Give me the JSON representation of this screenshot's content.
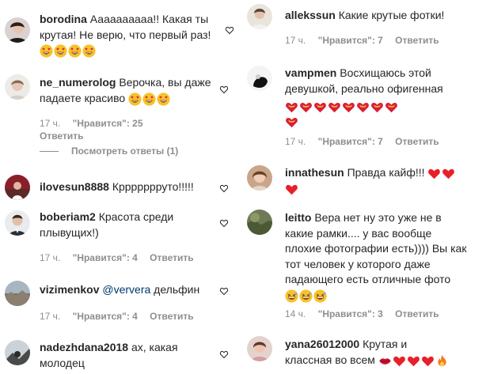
{
  "comments_left": [
    {
      "username": "borodina",
      "text": "Аааааааааа!! Какая ты крутая! Не верю, что первый раз!",
      "emojis": [
        "heart-eyes",
        "heart-eyes",
        "heart-eyes",
        "heart-eyes"
      ]
    },
    {
      "username": "ne_numerolog",
      "text": "Верочка, вы даже падаете красиво",
      "emojis": [
        "heart-eyes",
        "heart-eyes",
        "heart-eyes"
      ],
      "time": "17 ч.",
      "likes": "\"Нравится\": 25",
      "reply": "Ответить",
      "view_replies": "Посмотреть ответы (1)"
    },
    {
      "username": "ilovesun8888",
      "text": "Кррррррруто!!!!!"
    },
    {
      "username": "boberiam2",
      "text": "Красота среди плывущих!)",
      "time": "17 ч.",
      "likes": "\"Нравится\": 4",
      "reply": "Ответить"
    },
    {
      "username": "vizimenkov",
      "mention": "@ververa",
      "text": "дельфин",
      "time": "17 ч.",
      "likes": "\"Нравится\": 4",
      "reply": "Ответить"
    },
    {
      "username": "nadezhdana2018",
      "text": "ах, какая молодец"
    }
  ],
  "comments_right": [
    {
      "username": "allekssun",
      "text": "Какие крутые фотки!",
      "time": "17 ч.",
      "likes": "\"Нравится\": 7",
      "reply": "Ответить"
    },
    {
      "username": "vampmen",
      "text": "Восхищаюсь этой девушкой, реально офигенная",
      "emojis": [
        "heart-ribbon",
        "heart-ribbon",
        "heart-ribbon",
        "heart-ribbon",
        "heart-ribbon",
        "heart-ribbon",
        "heart-ribbon",
        "heart-ribbon",
        "heart-ribbon"
      ],
      "time": "17 ч.",
      "likes": "\"Нравится\": 7",
      "reply": "Ответить"
    },
    {
      "username": "innathesun",
      "text": "Правда кайф!!!",
      "emojis": [
        "red-heart",
        "red-heart",
        "red-heart"
      ]
    },
    {
      "username": "leitto",
      "text": "Вера нет ну это уже не в какие рамки.... у вас вообще плохие фотографии есть)))) Вы как тот человек у которого даже падающего есть отличные фото",
      "emojis": [
        "grin-sweat",
        "grin-sweat",
        "grin-sweat"
      ],
      "time": "14 ч.",
      "likes": "\"Нравится\": 3",
      "reply": "Ответить"
    },
    {
      "username": "yana26012000",
      "text": "Крутая и классная во всем",
      "emojis": [
        "lips",
        "red-heart",
        "red-heart",
        "red-heart",
        "fire"
      ]
    }
  ],
  "colors": {
    "text": "#262626",
    "secondary": "#8e8e8e",
    "mention": "#00376b",
    "heart_red": "#e8202a"
  }
}
